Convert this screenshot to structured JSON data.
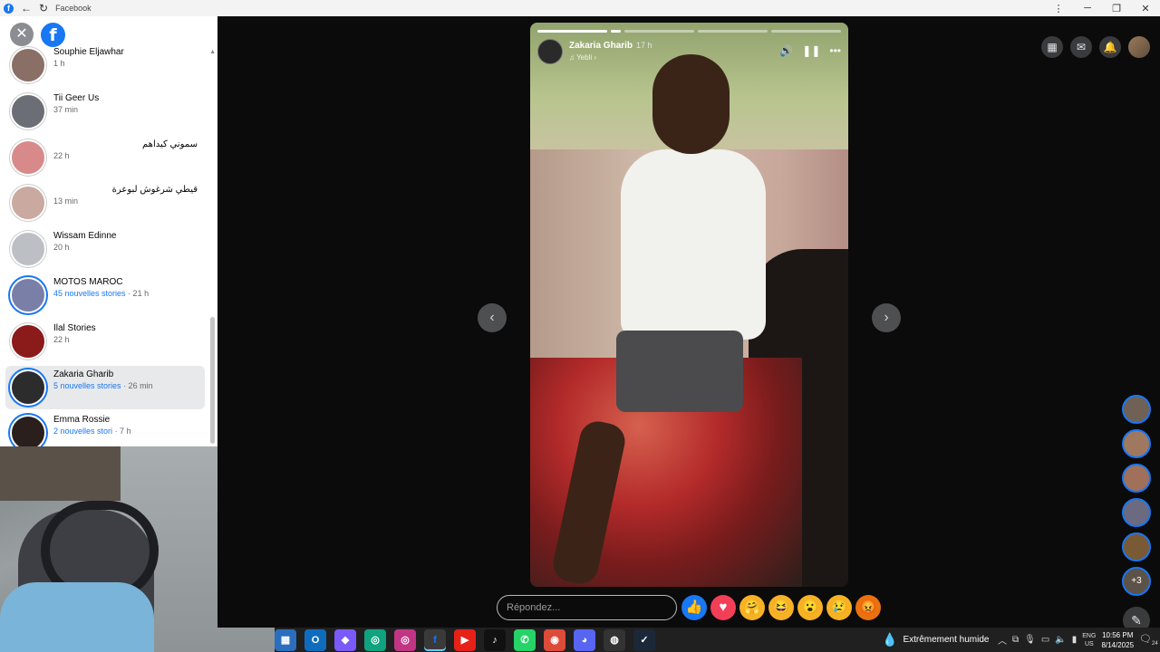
{
  "window": {
    "title": "Facebook",
    "controls": [
      "⋮",
      "─",
      "❐",
      "✕"
    ]
  },
  "sidebar": {
    "stories": [
      {
        "name": "Souphie Eljawhar",
        "time": "1 h",
        "new": "",
        "rtl": false,
        "seen": true,
        "color": "#8a6f66"
      },
      {
        "name": "Tii Geer Us",
        "time": "37 min",
        "new": "",
        "rtl": false,
        "seen": true,
        "color": "#6b6f75"
      },
      {
        "name": "سموني كيداهم",
        "time": "22 h",
        "new": "",
        "rtl": true,
        "seen": true,
        "color": "#d88a8a"
      },
      {
        "name": "قيطي شرغوش لبوعرة",
        "time": "13 min",
        "new": "",
        "rtl": true,
        "seen": true,
        "color": "#c9a9a0"
      },
      {
        "name": "Wissam Edinne",
        "time": "20 h",
        "new": "",
        "rtl": false,
        "seen": true,
        "color": "#bcc0c4"
      },
      {
        "name": "MOTOS MAROC",
        "time": "· 21 h",
        "new": "45 nouvelles stories",
        "rtl": false,
        "seen": false,
        "color": "#7a7fa8"
      },
      {
        "name": "Ilal Stories",
        "time": "22 h",
        "new": "",
        "rtl": false,
        "seen": true,
        "color": "#8b1a1a"
      },
      {
        "name": "Zakaria Gharib",
        "time": "· 26 min",
        "new": "5 nouvelles stories",
        "rtl": false,
        "seen": false,
        "color": "#2c2c2c"
      },
      {
        "name": "Emma Rossie",
        "time": "· 7 h",
        "new": "2 nouvelles stori",
        "rtl": false,
        "seen": false,
        "color": "#2a1f1c"
      }
    ]
  },
  "story": {
    "author": "Zakaria Gharib",
    "time": "17 h",
    "music": "♫ Yebli ›",
    "reply_placeholder": "Répondez..."
  },
  "reactions": [
    {
      "name": "like",
      "glyph": "👍",
      "color": "#1877f2"
    },
    {
      "name": "love",
      "glyph": "♥",
      "color": "#f33e58"
    },
    {
      "name": "care",
      "glyph": "🤗",
      "color": "#f7b125"
    },
    {
      "name": "haha",
      "glyph": "😆",
      "color": "#f7b125"
    },
    {
      "name": "wow",
      "glyph": "😮",
      "color": "#f7b125"
    },
    {
      "name": "sad",
      "glyph": "😢",
      "color": "#f7b125"
    },
    {
      "name": "angry",
      "glyph": "😡",
      "color": "#e9710f"
    }
  ],
  "right_avatars": {
    "more_label": "+3"
  },
  "taskbar": {
    "apps": [
      {
        "name": "files",
        "label": "▦",
        "color": "#2a6ebd"
      },
      {
        "name": "outlook",
        "label": "O",
        "color": "#0f6cbd"
      },
      {
        "name": "copilot",
        "label": "◆",
        "color": "#7a5af8"
      },
      {
        "name": "app-green",
        "label": "◎",
        "color": "#10a37f"
      },
      {
        "name": "instagram",
        "label": "◎",
        "color": "#c13584"
      },
      {
        "name": "facebook",
        "label": "f",
        "color": "#1877f2"
      },
      {
        "name": "youtube",
        "label": "▶",
        "color": "#e62117"
      },
      {
        "name": "tiktok",
        "label": "♪",
        "color": "#111111"
      },
      {
        "name": "whatsapp",
        "label": "✆",
        "color": "#25d366"
      },
      {
        "name": "chrome",
        "label": "◉",
        "color": "#dd4b39"
      },
      {
        "name": "discord",
        "label": "◕",
        "color": "#5865f2"
      },
      {
        "name": "game",
        "label": "◍",
        "color": "#333333"
      },
      {
        "name": "steam",
        "label": "✓",
        "color": "#1b2838"
      }
    ],
    "weather": "Extrêmement humide",
    "lang_top": "ENG",
    "lang_bottom": "US",
    "time": "10:56 PM",
    "date": "8/14/2025",
    "notifications": "24"
  }
}
